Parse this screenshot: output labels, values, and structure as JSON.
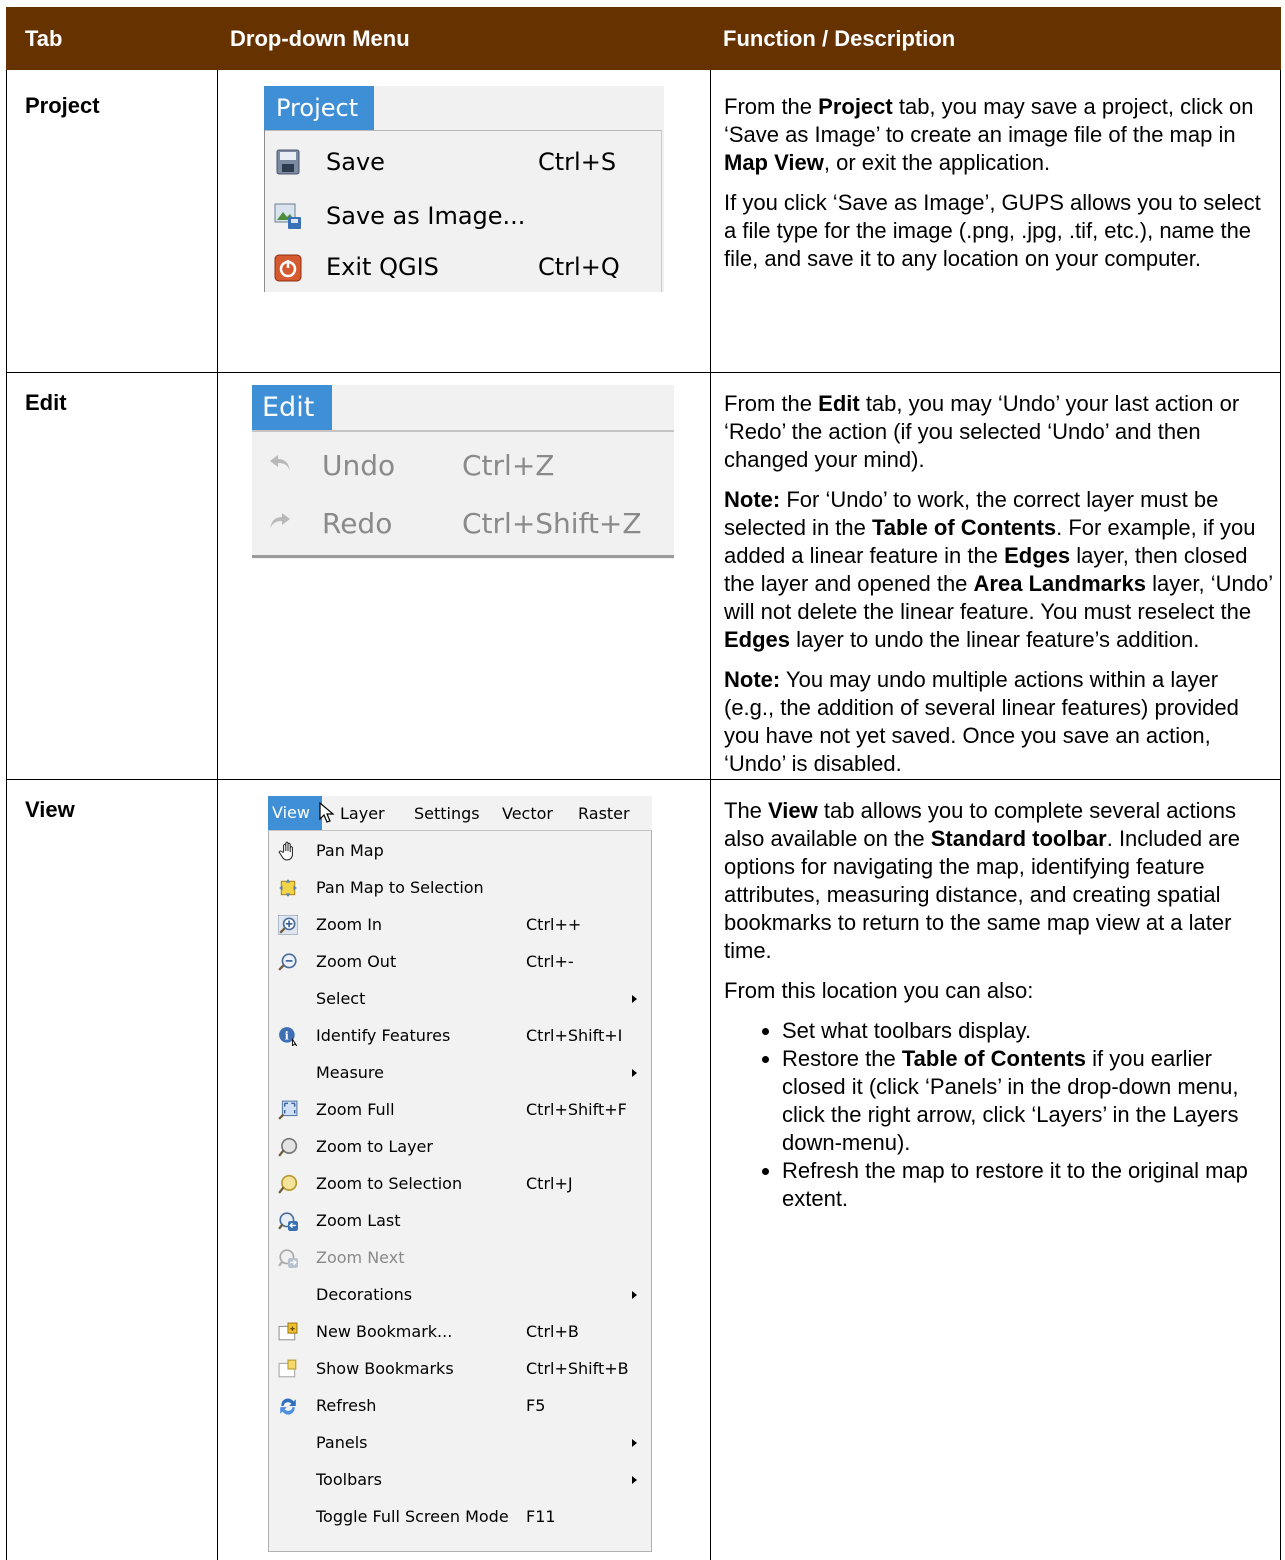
{
  "table": {
    "headers": {
      "tab": "Tab",
      "menu": "Drop-down Menu",
      "desc": "Function / Description"
    }
  },
  "rows": {
    "project": {
      "tab": "Project",
      "menu": {
        "title": "Project",
        "items": [
          {
            "label": "Save",
            "shortcut": "Ctrl+S",
            "icon": "save-icon"
          },
          {
            "label": "Save as Image...",
            "shortcut": "",
            "icon": "save-image-icon"
          },
          {
            "label": "Exit QGIS",
            "shortcut": "Ctrl+Q",
            "icon": "exit-icon"
          }
        ]
      },
      "desc": {
        "p1_a": "From the ",
        "p1_b": "Project",
        "p1_c": " tab, you may save a project, click on ‘Save as Image’ to create an image file of the map in ",
        "p1_d": "Map View",
        "p1_e": ", or exit the application.",
        "p2": "If you click ‘Save as Image’, GUPS allows you to select a file type for the image (.png, .jpg, .tif, etc.), name the file, and save it to any location on your computer."
      }
    },
    "edit": {
      "tab": "Edit",
      "menu": {
        "title": "Edit",
        "items": [
          {
            "label": "Undo",
            "shortcut": "Ctrl+Z",
            "icon": "undo-icon"
          },
          {
            "label": "Redo",
            "shortcut": "Ctrl+Shift+Z",
            "icon": "redo-icon"
          }
        ]
      },
      "desc": {
        "p1_a": "From the ",
        "p1_b": "Edit",
        "p1_c": " tab, you may ‘Undo’ your last action or ‘Redo’ the action (if you selected ‘Undo’ and then changed your mind).",
        "note": "Note:",
        "p2_a": "  For ‘Undo’ to work, the correct layer must be selected in the ",
        "p2_b": "Table of Contents",
        "p2_c": ". For example, if you added a linear feature in the ",
        "p2_d": "Edges",
        "p2_e": " layer, then closed the layer and opened the ",
        "p2_f": "Area Landmarks",
        "p2_g": " layer, ‘Undo’ will not delete the linear feature. You must reselect the ",
        "p2_h": "Edges",
        "p2_i": " layer to undo the linear feature’s addition.",
        "p3": "  You may undo multiple actions within a layer (e.g., the addition of several linear features) provided you have not yet saved. Once you save an action, ‘Undo’ is disabled."
      }
    },
    "view": {
      "tab": "View",
      "menu": {
        "menubar": [
          "View",
          "Layer",
          "Settings",
          "Vector",
          "Raster"
        ],
        "items": [
          {
            "label": "Pan Map",
            "shortcut": "",
            "icon": "pan-hand-icon"
          },
          {
            "label": "Pan Map to Selection",
            "shortcut": "",
            "icon": "pan-selection-icon"
          },
          {
            "label": "Zoom In",
            "shortcut": "Ctrl++",
            "icon": "zoom-in-icon"
          },
          {
            "label": "Zoom Out",
            "shortcut": "Ctrl+-",
            "icon": "zoom-out-icon"
          },
          {
            "label": "Select",
            "shortcut": "",
            "icon": ""
          },
          {
            "label": "Identify Features",
            "shortcut": "Ctrl+Shift+I",
            "icon": "identify-icon"
          },
          {
            "label": "Measure",
            "shortcut": "",
            "icon": ""
          },
          {
            "label": "Zoom Full",
            "shortcut": "Ctrl+Shift+F",
            "icon": "zoom-full-icon"
          },
          {
            "label": "Zoom to Layer",
            "shortcut": "",
            "icon": "zoom-layer-icon"
          },
          {
            "label": "Zoom to Selection",
            "shortcut": "Ctrl+J",
            "icon": "zoom-selection-icon"
          },
          {
            "label": "Zoom Last",
            "shortcut": "",
            "icon": "zoom-last-icon"
          },
          {
            "label": "Zoom Next",
            "shortcut": "",
            "icon": "zoom-next-icon"
          },
          {
            "label": "Decorations",
            "shortcut": "",
            "icon": ""
          },
          {
            "label": "New Bookmark...",
            "shortcut": "Ctrl+B",
            "icon": "new-bookmark-icon"
          },
          {
            "label": "Show Bookmarks",
            "shortcut": "Ctrl+Shift+B",
            "icon": "show-bookmarks-icon"
          },
          {
            "label": "Refresh",
            "shortcut": "F5",
            "icon": "refresh-icon"
          },
          {
            "label": "Panels",
            "shortcut": "",
            "icon": ""
          },
          {
            "label": "Toolbars",
            "shortcut": "",
            "icon": ""
          },
          {
            "label": "Toggle Full Screen Mode",
            "shortcut": "F11",
            "icon": ""
          }
        ]
      },
      "desc": {
        "p1_a": "The ",
        "p1_b": "View",
        "p1_c": " tab allows you to complete several actions also available on the ",
        "p1_d": "Standard toolbar",
        "p1_e": ". Included are options for navigating the map, identifying feature attributes, measuring distance, and creating spatial bookmarks to return to the same map view at a later time.",
        "p2": "From this location you can also:",
        "b1": "Set what toolbars display.",
        "b2_a": "Restore the ",
        "b2_b": "Table of Contents",
        "b2_c": " if you earlier closed it (click ‘Panels’ in the drop-down menu, click the right arrow, click ‘Layers’ in the Layers down-menu).",
        "b3": "Refresh the map to restore it to the original map extent."
      }
    }
  }
}
